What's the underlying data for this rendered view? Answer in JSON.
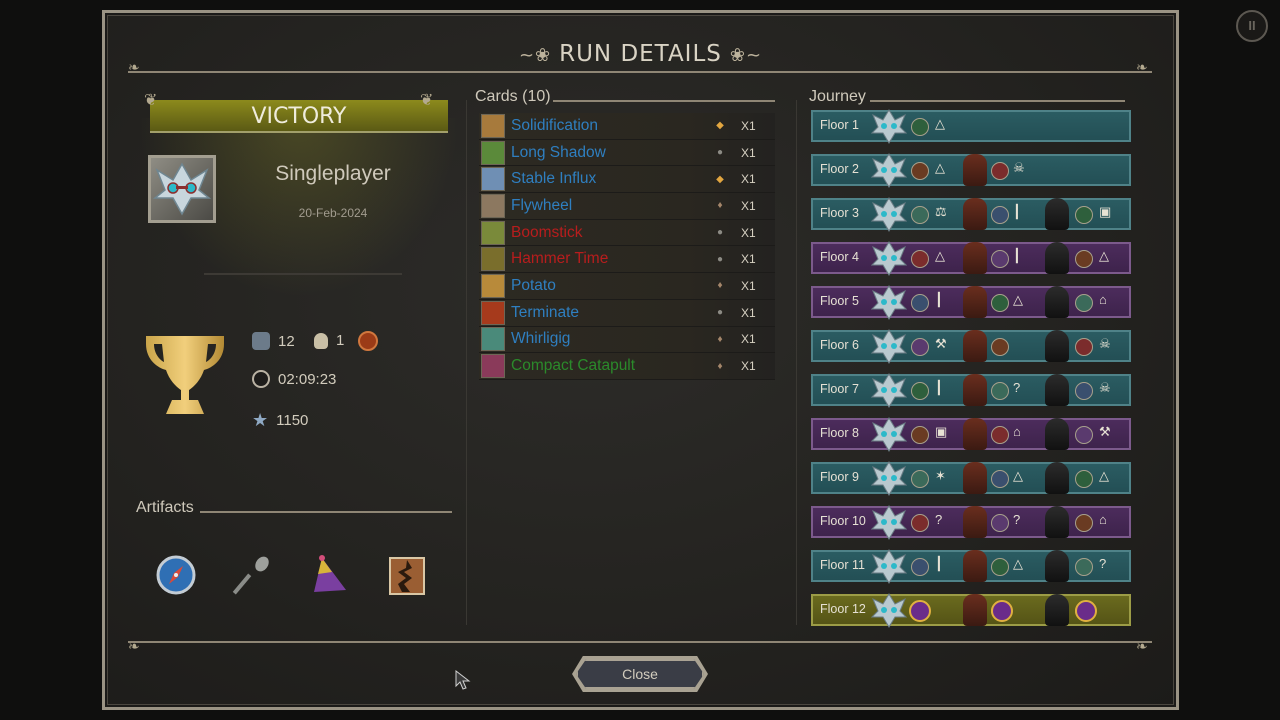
{
  "title": "RUN DETAILS",
  "result": "VICTORY",
  "mode": "Singleplayer",
  "date": "20-Feb-2024",
  "stats": {
    "allies": "12",
    "deaths": "1",
    "time": "02:09:23",
    "score": "1150"
  },
  "artifacts_label": "Artifacts",
  "artifacts": [
    {
      "icon": "compass-icon",
      "color": "#3a7fc4"
    },
    {
      "icon": "spoon-icon",
      "color": "#8d8f8c"
    },
    {
      "icon": "party-hat-icon",
      "color": "#7a3fa0"
    },
    {
      "icon": "stone-tablet-icon",
      "color": "#9a5e33"
    }
  ],
  "cards_label": "Cards (10)",
  "cards": [
    {
      "name": "Solidification",
      "color": "#2f7fc0",
      "rarity": "gold",
      "qty": "X1"
    },
    {
      "name": "Long Shadow",
      "color": "#2f7fc0",
      "rarity": "grey",
      "qty": "X1"
    },
    {
      "name": "Stable Influx",
      "color": "#2f7fc0",
      "rarity": "gold",
      "qty": "X1"
    },
    {
      "name": "Flywheel",
      "color": "#2f7fc0",
      "rarity": "diamond",
      "qty": "X1"
    },
    {
      "name": "Boomstick",
      "color": "#b81d1d",
      "rarity": "grey",
      "qty": "X1"
    },
    {
      "name": "Hammer Time",
      "color": "#b81d1d",
      "rarity": "grey",
      "qty": "X1"
    },
    {
      "name": "Potato",
      "color": "#2f7fc0",
      "rarity": "diamond",
      "qty": "X1"
    },
    {
      "name": "Terminate",
      "color": "#2f7fc0",
      "rarity": "grey",
      "qty": "X1"
    },
    {
      "name": "Whirligig",
      "color": "#2f7fc0",
      "rarity": "diamond",
      "qty": "X1"
    },
    {
      "name": "Compact Catapult",
      "color": "#2b8a2b",
      "rarity": "diamond",
      "qty": "X1"
    }
  ],
  "journey_label": "Journey",
  "floors": [
    {
      "label": "Floor 1",
      "theme": "teal"
    },
    {
      "label": "Floor 2",
      "theme": "teal"
    },
    {
      "label": "Floor 3",
      "theme": "teal"
    },
    {
      "label": "Floor 4",
      "theme": "purple"
    },
    {
      "label": "Floor 5",
      "theme": "purple"
    },
    {
      "label": "Floor 6",
      "theme": "teal"
    },
    {
      "label": "Floor 7",
      "theme": "teal"
    },
    {
      "label": "Floor 8",
      "theme": "purple"
    },
    {
      "label": "Floor 9",
      "theme": "teal"
    },
    {
      "label": "Floor 10",
      "theme": "purple"
    },
    {
      "label": "Floor 11",
      "theme": "teal"
    },
    {
      "label": "Floor 12",
      "theme": "gold"
    }
  ],
  "close_label": "Close"
}
